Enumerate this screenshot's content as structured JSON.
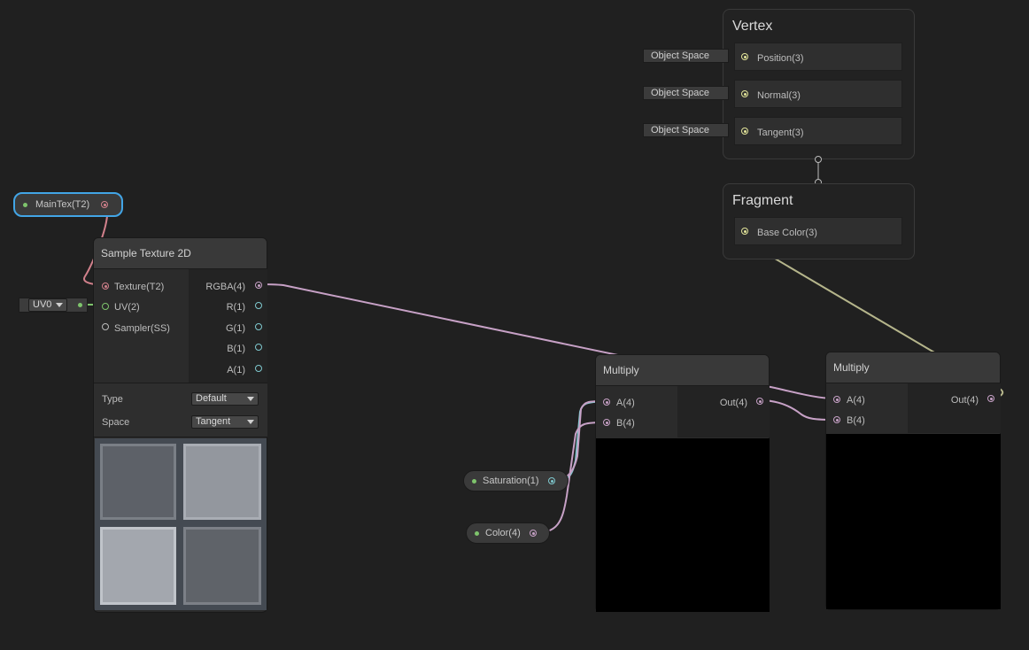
{
  "colors": {
    "background": "#202020",
    "texture_wire": "#d1808b",
    "vector_wire": "#c7a1c6",
    "float_wire": "#7fc9cf",
    "uv_wire": "#7ec46c",
    "base_color_wire": "#b5b58b",
    "vertex_port": "#e3e59a",
    "selection": "#42a5e6"
  },
  "vertex_stack": {
    "title": "Vertex",
    "rows": [
      {
        "space": "Object Space",
        "label": "Position(3)"
      },
      {
        "space": "Object Space",
        "label": "Normal(3)"
      },
      {
        "space": "Object Space",
        "label": "Tangent(3)"
      }
    ]
  },
  "fragment_stack": {
    "title": "Fragment",
    "rows": [
      {
        "label": "Base Color(3)"
      }
    ]
  },
  "maintex_property": {
    "label": "MainTex(T2)",
    "icon": "property-dot"
  },
  "uv_input": {
    "value": "UV0"
  },
  "sample_texture": {
    "title": "Sample Texture 2D",
    "inputs": [
      "Texture(T2)",
      "UV(2)",
      "Sampler(SS)"
    ],
    "outputs": [
      "RGBA(4)",
      "R(1)",
      "G(1)",
      "B(1)",
      "A(1)"
    ],
    "type_label": "Type",
    "type_value": "Default",
    "space_label": "Space",
    "space_value": "Tangent"
  },
  "multiply_1": {
    "title": "Multiply",
    "inputs": [
      "A(4)",
      "B(4)"
    ],
    "output": "Out(4)"
  },
  "multiply_2": {
    "title": "Multiply",
    "inputs": [
      "A(4)",
      "B(4)"
    ],
    "output": "Out(4)"
  },
  "saturation_property": {
    "label": "Saturation(1)"
  },
  "color_property": {
    "label": "Color(4)"
  }
}
